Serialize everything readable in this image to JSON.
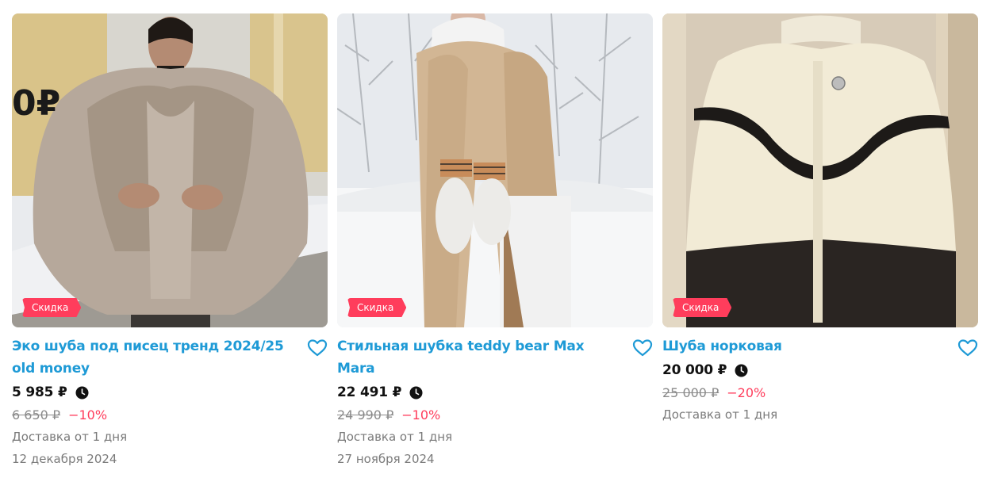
{
  "products": [
    {
      "badge": "Скидка",
      "title": "Эко шуба под писец тренд 2024/25 old money",
      "price": "5 985 ₽",
      "old_price": "6 650 ₽",
      "discount": "−10%",
      "delivery": "Доставка от 1 дня",
      "date": "12 декабря 2024",
      "photo_overlay_text": "0₽"
    },
    {
      "badge": "Скидка",
      "title": "Стильная шубка teddy bear Max Mara",
      "price": "22 491 ₽",
      "old_price": "24 990 ₽",
      "discount": "−10%",
      "delivery": "Доставка от 1 дня",
      "date": "27 ноября 2024"
    },
    {
      "badge": "Скидка",
      "title": "Шуба норковая",
      "price": "20 000 ₽",
      "old_price": "25 000 ₽",
      "discount": "−20%",
      "delivery": "Доставка от 1 дня"
    }
  ],
  "icons": {
    "favorite": "heart-outline-icon",
    "clock": "clock-icon"
  },
  "colors": {
    "title": "#1e9ad6",
    "badge": "#ff3d5c",
    "discount": "#ff3d5c",
    "heart": "#1e9ad6"
  }
}
